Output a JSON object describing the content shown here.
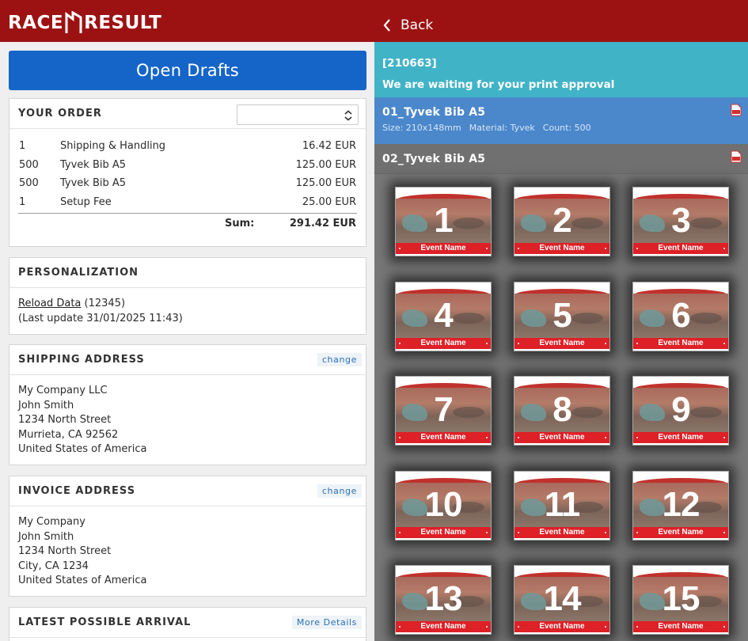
{
  "app": {
    "brand_left": "RACE",
    "brand_right": "RESULT"
  },
  "left": {
    "open_drafts_label": "Open Drafts",
    "order": {
      "heading": "YOUR ORDER",
      "select_value": "",
      "rows": [
        {
          "qty": "1",
          "item": "Shipping & Handling",
          "price": "16.42 EUR"
        },
        {
          "qty": "500",
          "item": "Tyvek Bib A5",
          "price": "125.00 EUR"
        },
        {
          "qty": "500",
          "item": "Tyvek Bib A5",
          "price": "125.00 EUR"
        },
        {
          "qty": "1",
          "item": "Setup Fee",
          "price": "25.00 EUR"
        }
      ],
      "sum_label": "Sum:",
      "sum_value": "291.42 EUR"
    },
    "personalization": {
      "heading": "PERSONALIZATION",
      "reload_link": "Reload Data",
      "reload_count": "(12345)",
      "last_update": "(Last update 31/01/2025 11:43)"
    },
    "shipping": {
      "heading": "SHIPPING ADDRESS",
      "change_label": "change",
      "lines": [
        "My Company LLC",
        "John Smith",
        "1234 North Street",
        "Murrieta, CA 92562",
        "United States of America"
      ]
    },
    "invoice": {
      "heading": "INVOICE ADDRESS",
      "change_label": "change",
      "lines": [
        "My Company",
        "John Smith",
        "1234 North Street",
        "City, CA 1234",
        "United States of America"
      ]
    },
    "arrival": {
      "heading": "LATEST POSSIBLE ARRIVAL",
      "more_label": "More Details"
    }
  },
  "right": {
    "back_label": "Back",
    "order_id": "[210663]",
    "approval_message": "We are waiting for your print approval",
    "draft1": {
      "title": "01_Tyvek Bib A5",
      "size": "Size: 210x148mm",
      "material": "Material: Tyvek",
      "count": "Count: 500"
    },
    "draft2": {
      "title": "02_Tyvek Bib A5"
    },
    "bib_event_name": "Event Name",
    "bibs": [
      "1",
      "2",
      "3",
      "4",
      "5",
      "6",
      "7",
      "8",
      "9",
      "10",
      "11",
      "12",
      "13",
      "14",
      "15"
    ]
  },
  "colors": {
    "brand_red": "#9c1213",
    "primary_blue": "#1565c9",
    "approval_teal": "#41b3c7",
    "draft_blue": "#4b87cb",
    "bib_red": "#de2027"
  },
  "icons": {
    "back": "chevron-left-icon",
    "pdf": "pdf-icon",
    "select": "select-arrows-icon"
  }
}
